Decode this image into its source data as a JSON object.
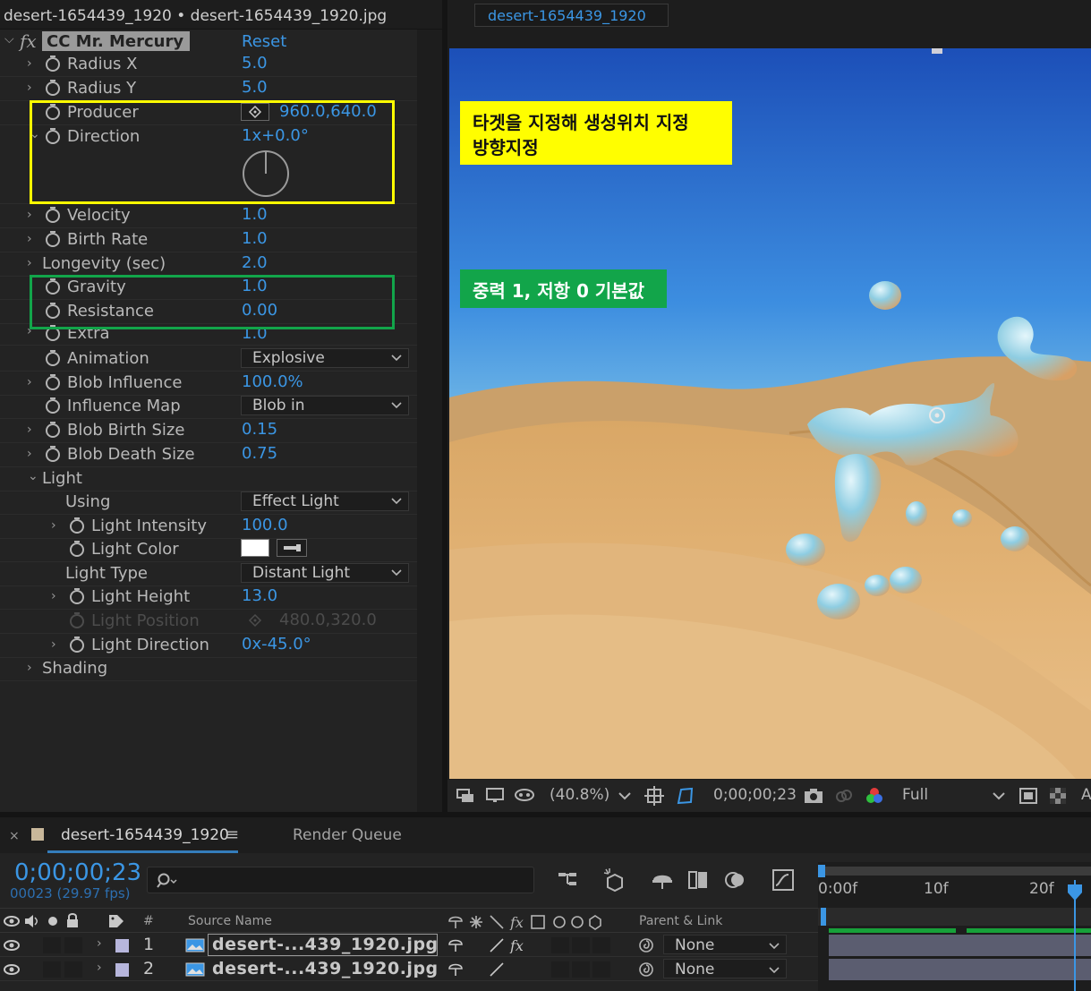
{
  "effect_panel": {
    "title": "desert-1654439_1920 • desert-1654439_1920.jpg",
    "fx_label": "fx",
    "effect_name": "CC Mr. Mercury",
    "reset_label": "Reset",
    "radius_x": {
      "label": "Radius X",
      "value": "5.0"
    },
    "radius_y": {
      "label": "Radius Y",
      "value": "5.0"
    },
    "producer": {
      "label": "Producer",
      "value": "960.0,640.0"
    },
    "direction": {
      "label": "Direction",
      "value": "1x+0.0°"
    },
    "velocity": {
      "label": "Velocity",
      "value": "1.0"
    },
    "birth_rate": {
      "label": "Birth Rate",
      "value": "1.0"
    },
    "longevity": {
      "label": "Longevity (sec)",
      "value": "2.0"
    },
    "gravity": {
      "label": "Gravity",
      "value": "1.0"
    },
    "resistance": {
      "label": "Resistance",
      "value": "0.00"
    },
    "extra": {
      "label": "Extra",
      "value": "1.0"
    },
    "animation": {
      "label": "Animation",
      "value": "Explosive"
    },
    "blob_influence": {
      "label": "Blob Influence",
      "value": "100.0%"
    },
    "influence_map": {
      "label": "Influence Map",
      "value": "Blob in"
    },
    "blob_birth_size": {
      "label": "Blob Birth Size",
      "value": "0.15"
    },
    "blob_death_size": {
      "label": "Blob Death Size",
      "value": "0.75"
    },
    "light_group": {
      "label": "Light"
    },
    "using": {
      "label": "Using",
      "value": "Effect Light"
    },
    "light_intensity": {
      "label": "Light Intensity",
      "value": "100.0"
    },
    "light_color": {
      "label": "Light Color",
      "value": "#ffffff"
    },
    "light_type": {
      "label": "Light Type",
      "value": "Distant Light"
    },
    "light_height": {
      "label": "Light Height",
      "value": "13.0"
    },
    "light_position": {
      "label": "Light Position",
      "value": "480.0,320.0"
    },
    "light_direction": {
      "label": "Light Direction",
      "value": "0x-45.0°"
    },
    "shading": {
      "label": "Shading"
    }
  },
  "viewer": {
    "tab_label": "desert-1654439_1920",
    "zoom": "(40.8%)",
    "timecode": "0;00;00;23",
    "resolution": "Full",
    "partial_label": "A"
  },
  "annotations": {
    "yellow_line1": "타겟을 지정해 생성위치 지정",
    "yellow_line2": "방향지정",
    "green_text": "중력 1, 저항 0 기본값",
    "yellow_color": "#fffe00",
    "green_color": "#12a54a"
  },
  "timeline": {
    "close_icon": "×",
    "comp_tab": "desert-1654439_1920",
    "menu_icon": "≡",
    "render_queue": "Render Queue",
    "current_time": "0;00;00;23",
    "frame_info": "00023 (29.97 fps)",
    "headers": {
      "hash": "#",
      "source_name": "Source Name",
      "parent_link": "Parent & Link"
    },
    "ruler": [
      "0:00f",
      "10f",
      "20f"
    ],
    "layers": [
      {
        "num": "1",
        "name": "desert-...439_1920.jpg",
        "parent": "None"
      },
      {
        "num": "2",
        "name": "desert-...439_1920.jpg",
        "parent": "None"
      }
    ]
  }
}
